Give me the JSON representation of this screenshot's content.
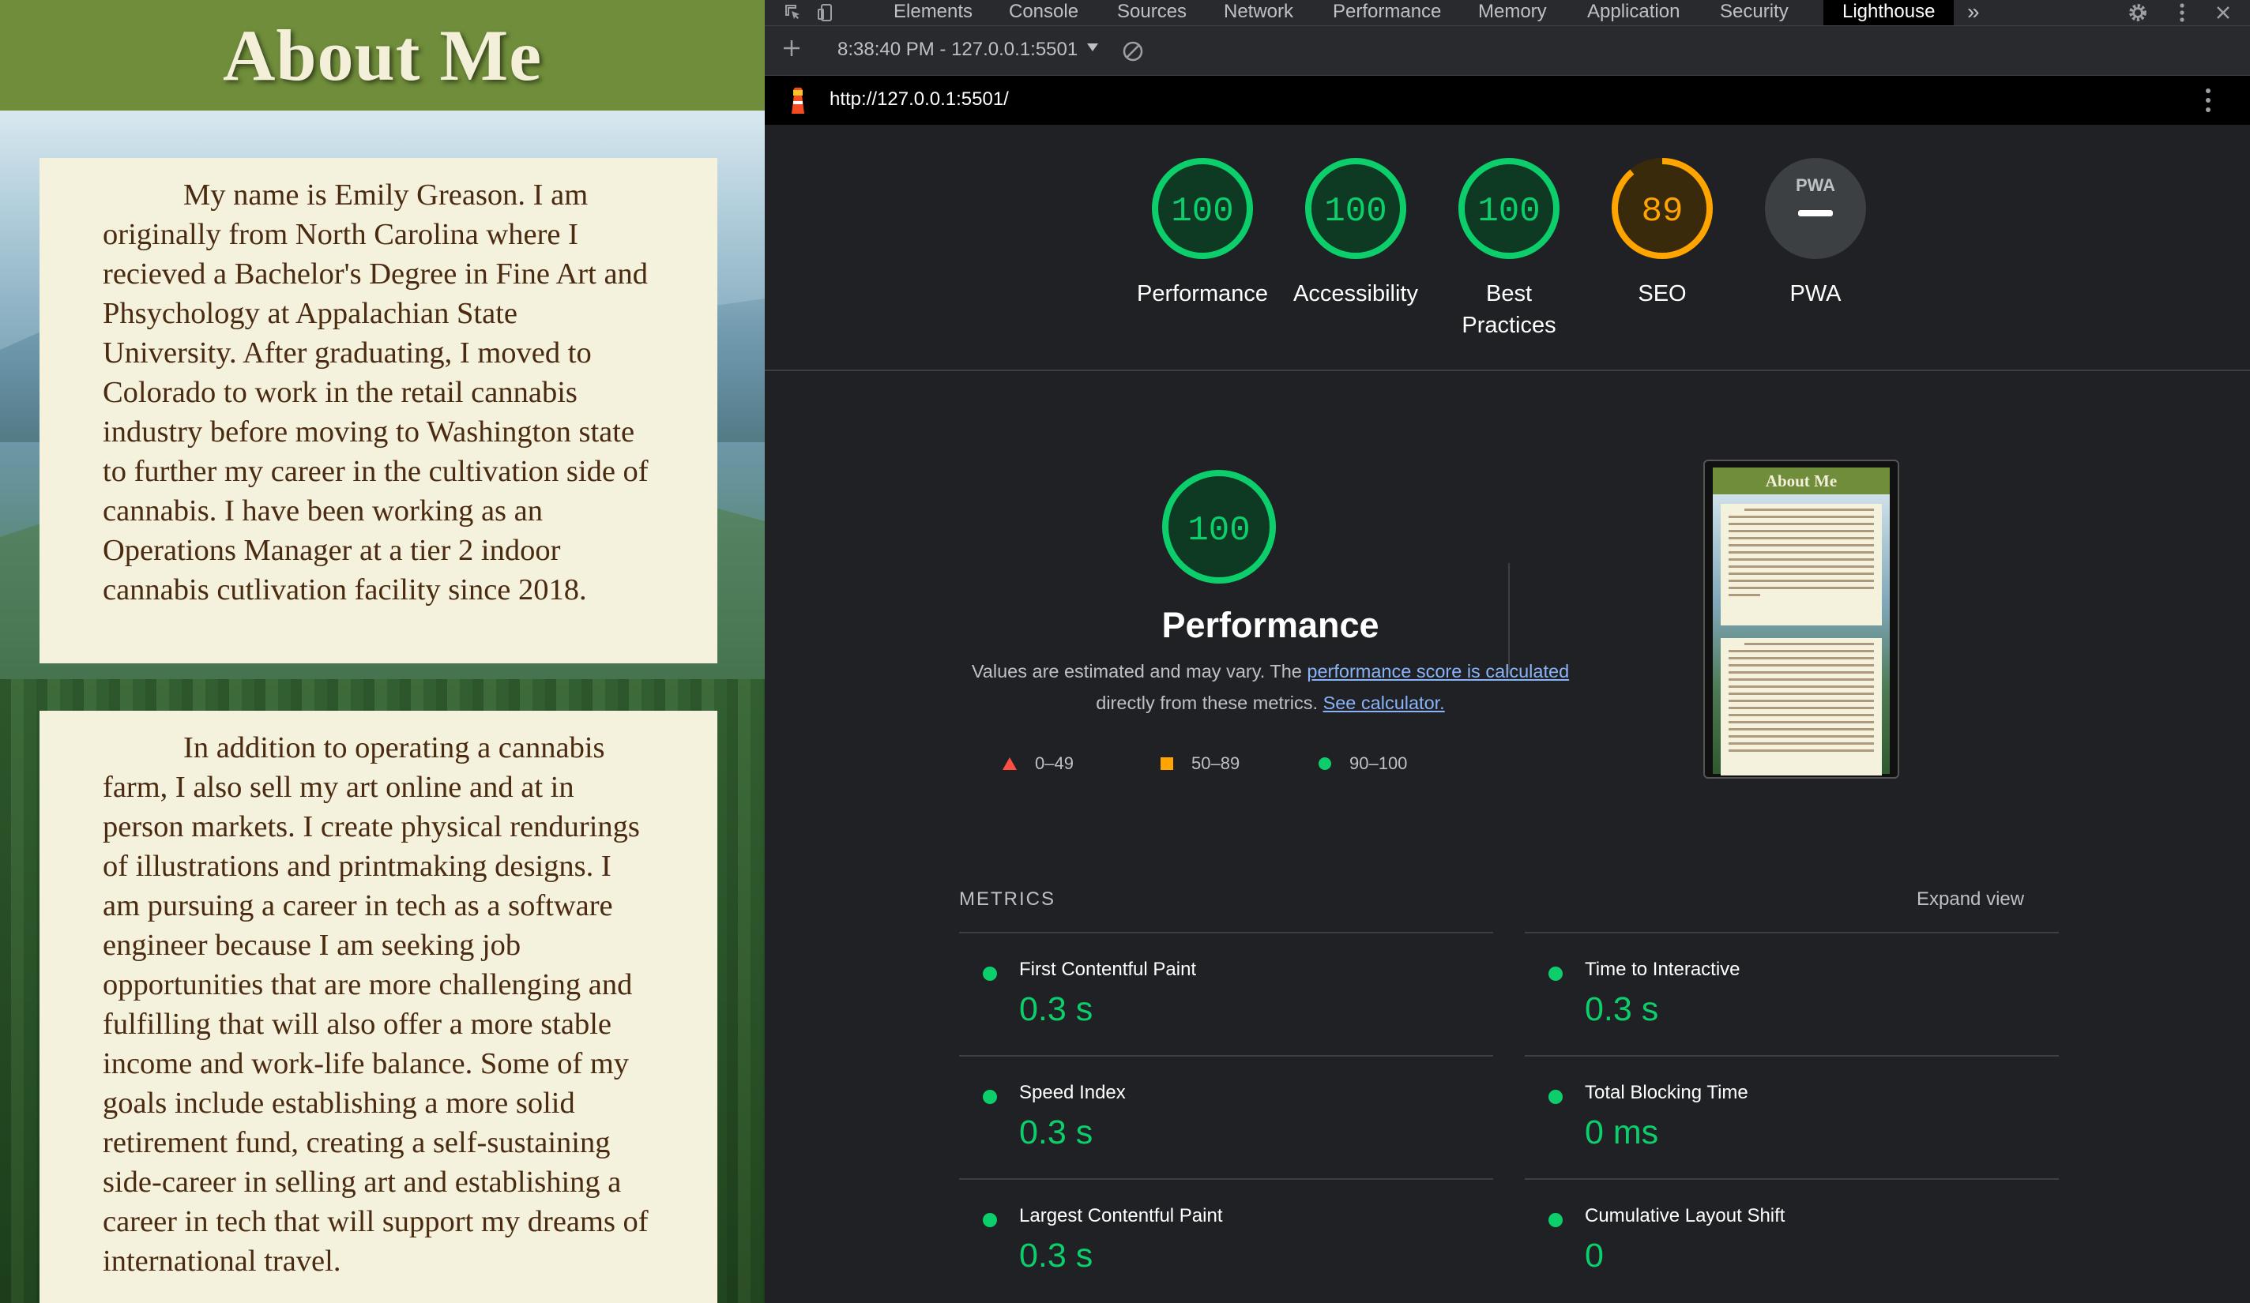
{
  "page": {
    "title": "About Me",
    "paragraph1": "My name is Emily Greason. I am originally from North Carolina where I recieved a Bachelor's Degree in Fine Art and Phsychology at Appalachian State University. After graduating, I moved to Colorado to work in the retail cannabis industry before moving to Washington state to further my career in the cultivation side of cannabis. I have been working as an Operations Manager at a tier 2 indoor cannabis cutlivation facility since 2018.",
    "paragraph2": "In addition to operating a cannabis farm, I also sell my art online and at in person markets. I create physical rendurings of illustrations and printmaking designs. I am pursuing a career in tech as a software engineer because I am seeking job opportunities that are more challenging and fulfilling that will also offer a more stable income and work-life balance. Some of my goals include establishing a more solid retirement fund, creating a self-sustaining side-career in selling art and establishing a career in tech that will support my dreams of international travel."
  },
  "devtools": {
    "tabs": [
      "Elements",
      "Console",
      "Sources",
      "Network",
      "Performance",
      "Memory",
      "Application",
      "Security",
      "Lighthouse"
    ],
    "active_tab": "Lighthouse",
    "more_tabs": "»",
    "report_selector": "8:38:40 PM - 127.0.0.1:5501",
    "url": "http://127.0.0.1:5501/",
    "gauges": [
      {
        "label": "Performance",
        "score": "100",
        "color": "#0cce6b",
        "fraction": 1.0
      },
      {
        "label": "Accessibility",
        "score": "100",
        "color": "#0cce6b",
        "fraction": 1.0
      },
      {
        "label": "Best Practices",
        "score": "100",
        "color": "#0cce6b",
        "fraction": 1.0
      },
      {
        "label": "SEO",
        "score": "89",
        "color": "#ffa400",
        "fraction": 0.89
      },
      {
        "label": "PWA",
        "score": "PWA",
        "color": "#9aa0a6",
        "fraction": 0
      }
    ],
    "performance": {
      "score": "100",
      "title": "Performance",
      "desc_prefix": "Values are estimated and may vary. The ",
      "desc_link1": "performance score is calculated",
      "desc_mid": " directly from these metrics. ",
      "desc_link2": "See calculator."
    },
    "legend": [
      {
        "range": "0–49",
        "color": "#ff4e42",
        "shape": "triangle"
      },
      {
        "range": "50–89",
        "color": "#ffa400",
        "shape": "square"
      },
      {
        "range": "90–100",
        "color": "#0cce6b",
        "shape": "circle"
      }
    ],
    "thumbnail_title": "About Me",
    "metrics_heading": "METRICS",
    "expand_label": "Expand view",
    "metrics": [
      {
        "name": "First Contentful Paint",
        "value": "0.3 s"
      },
      {
        "name": "Time to Interactive",
        "value": "0.3 s"
      },
      {
        "name": "Speed Index",
        "value": "0.3 s"
      },
      {
        "name": "Total Blocking Time",
        "value": "0 ms"
      },
      {
        "name": "Largest Contentful Paint",
        "value": "0.3 s"
      },
      {
        "name": "Cumulative Layout Shift",
        "value": "0"
      }
    ]
  }
}
